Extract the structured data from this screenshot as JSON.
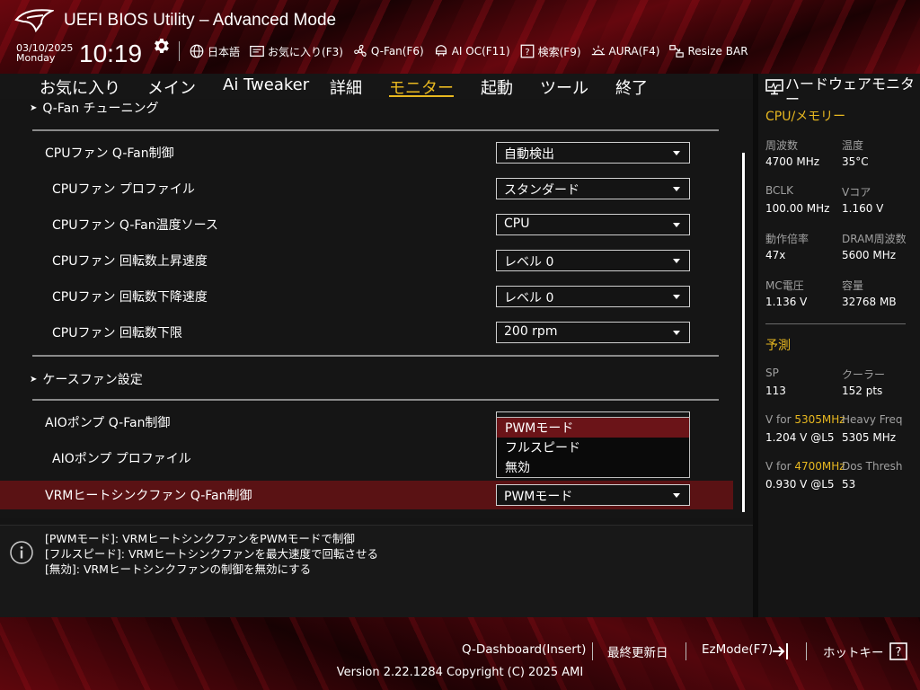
{
  "header": {
    "title": "UEFI BIOS Utility – Advanced Mode",
    "date": "03/10/2025",
    "day": "Monday",
    "time": "10:19",
    "tools": [
      {
        "label": "日本語",
        "icon": "globe-icon"
      },
      {
        "label": "お気に入り(F3)",
        "icon": "favorites-icon"
      },
      {
        "label": "Q-Fan(F6)",
        "icon": "fan-icon"
      },
      {
        "label": "AI OC(F11)",
        "icon": "ai-oc-icon"
      },
      {
        "label": "検索(F9)",
        "icon": "search-help-icon"
      },
      {
        "label": "AURA(F4)",
        "icon": "aura-icon"
      },
      {
        "label": "Resize BAR",
        "icon": "resize-bar-icon"
      }
    ]
  },
  "tabs": [
    "お気に入り",
    "メイン",
    "Ai Tweaker",
    "詳細",
    "モニター",
    "起動",
    "ツール",
    "終了"
  ],
  "active_tab": "モニター",
  "main": {
    "section_qfan": "Q-Fan チューニング",
    "section_case": "ケースファン設定",
    "settings": [
      {
        "label": "CPUファン Q-Fan制御",
        "value": "自動検出"
      },
      {
        "label": "CPUファン プロファイル",
        "value": "スタンダード"
      },
      {
        "label": "CPUファン Q-Fan温度ソース",
        "value": "CPU"
      },
      {
        "label": "CPUファン 回転数上昇速度",
        "value": "レベル 0"
      },
      {
        "label": "CPUファン 回転数下降速度",
        "value": "レベル 0"
      },
      {
        "label": "CPUファン 回転数下限",
        "value": "200 rpm"
      },
      {
        "label": "AIOポンプ Q-Fan制御",
        "value": ""
      },
      {
        "label": "AIOポンプ プロファイル",
        "value": ""
      },
      {
        "label": "VRMヒートシンクファン Q-Fan制御",
        "value": "PWMモード"
      }
    ],
    "popup_options": [
      "PWMモード",
      "フルスピード",
      "無効"
    ],
    "popup_selected": "PWMモード"
  },
  "help": [
    "[PWMモード]: VRMヒートシンクファンをPWMモードで制御",
    "[フルスピード]: VRMヒートシンクファンを最大速度で回転させる",
    "[無効]: VRMヒートシンクファンの制御を無効にする"
  ],
  "hw_monitor": {
    "title": "ハードウェアモニター",
    "cpu_mem_title": "CPU/メモリー",
    "cpu_mem": [
      {
        "k": "周波数",
        "v": "4700 MHz"
      },
      {
        "k": "温度",
        "v": "35°C"
      },
      {
        "k": "BCLK",
        "v": "100.00 MHz"
      },
      {
        "k": "Vコア",
        "v": "1.160 V"
      },
      {
        "k": "動作倍率",
        "v": "47x"
      },
      {
        "k": "DRAM周波数",
        "v": "5600 MHz"
      },
      {
        "k": "MC電圧",
        "v": "1.136 V"
      },
      {
        "k": "容量",
        "v": "32768 MB"
      }
    ],
    "predict_title": "予測",
    "sp_label": "SP",
    "sp_value": "113",
    "cooler_label": "クーラー",
    "cooler_value": "152 pts",
    "v_for_prefix": "V for ",
    "v1_freq": "5305MHz",
    "v1_value": "1.204 V @L5",
    "heavy_freq_label": "Heavy Freq",
    "heavy_freq_value": "5305 MHz",
    "v2_freq": "4700MHz",
    "v2_value": "0.930 V @L5",
    "dos_thresh_label": "Dos Thresh",
    "dos_thresh_value": "53"
  },
  "footer": {
    "qdashboard": "Q-Dashboard(Insert)",
    "last_modified": "最終更新日",
    "ezmode": "EzMode(F7)",
    "hotkeys": "ホットキー",
    "version": "Version 2.22.1284 Copyright (C) 2025 AMI"
  },
  "colors": {
    "accent": "#e8b820",
    "selected_row": "#5a1214",
    "brand_red": "#a00a14"
  }
}
